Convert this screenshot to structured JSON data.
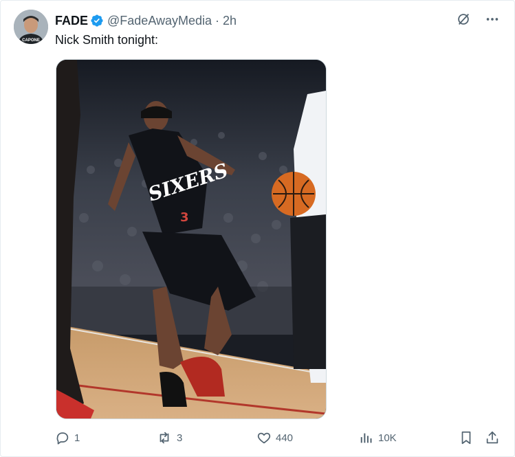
{
  "author": {
    "display_name": "FADE",
    "handle": "@FadeAwayMedia",
    "separator": "·",
    "timestamp": "2h",
    "verified": true,
    "avatar_text": "CAPONE"
  },
  "post": {
    "text": "Nick Smith tonight:",
    "media": {
      "jersey_text": "SIXERS",
      "jersey_number": "3"
    }
  },
  "actions": {
    "replies": "1",
    "reposts": "3",
    "likes": "440",
    "views": "10K"
  },
  "icons": [
    "grok-icon",
    "more-icon",
    "reply-icon",
    "repost-icon",
    "like-icon",
    "views-icon",
    "bookmark-icon",
    "share-icon"
  ],
  "colors": {
    "verified_blue": "#1d9bf0",
    "text_primary": "#0f1419",
    "text_secondary": "#536471"
  }
}
